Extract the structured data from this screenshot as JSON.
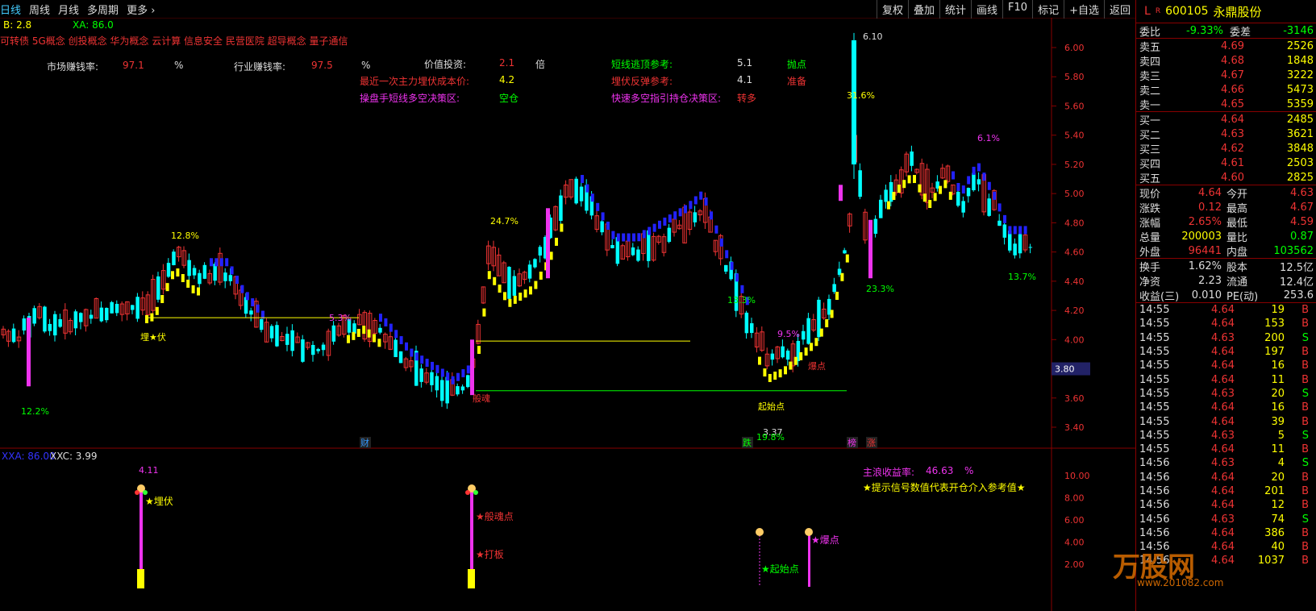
{
  "toolbar": {
    "left_tabs": [
      "日线",
      "周线",
      "月线",
      "多周期",
      "更多 ›"
    ],
    "right_buttons": [
      "复权",
      "叠加",
      "统计",
      "画线",
      "F10",
      "标记",
      "+自选",
      "返回"
    ]
  },
  "indicators_top": {
    "b_label": "B: 2.8",
    "xa_label": "XA: 86.0"
  },
  "concepts": "可转债 5G概念 创投概念 华为概念 云计算 信息安全 民营医院 超导概念 量子通信",
  "info_panel": {
    "market_label": "市场赚钱率:",
    "market_value": "97.1",
    "pct1": "%",
    "industry_label": "行业赚钱率:",
    "industry_value": "97.5",
    "pct2": "%",
    "value_invest_label": "价值投资:",
    "value_invest_value": "2.1",
    "times": "倍",
    "cost_label": "最近一次主力埋伏成本价:",
    "cost_value": "4.2",
    "strategy_label": "操盘手短线多空决策区:",
    "strategy_value": "空仓",
    "escape_label": "短线逃顶参考:",
    "escape_value": "5.1",
    "escape_signal": "抛点",
    "ambush_label": "埋伏反弹参考:",
    "ambush_value": "4.1",
    "ambush_signal": "准备",
    "fast_label": "快速多空指引持仓决策区:",
    "fast_value": "转多"
  },
  "chart_data": {
    "type": "candlestick",
    "y_ticks": [
      "6.00",
      "5.80",
      "5.60",
      "5.40",
      "5.20",
      "5.00",
      "4.80",
      "4.60",
      "4.40",
      "4.20",
      "4.00",
      "3.80",
      "3.60",
      "3.40"
    ],
    "ylim": [
      3.3,
      6.15
    ],
    "current_price_tag": "3.80",
    "annotations": [
      "12.2%",
      "12.8%",
      "埋★伏",
      "5.3%",
      "24.7%",
      "般魂",
      "13.3%",
      "9.5%",
      "爆点",
      "起始点",
      "3.37",
      "19.8%",
      "6.10",
      "31.6%",
      "23.3%",
      "6.1%",
      "13.7%"
    ],
    "bottom_markers": [
      "财",
      "跌",
      "榜",
      "涨"
    ],
    "sub_chart": {
      "legend_xxa": "XXA: 86.00",
      "legend_xxc": "XXC: 3.99",
      "y_ticks": [
        "10.00",
        "8.00",
        "6.00",
        "4.00",
        "2.00"
      ],
      "top_label": "4.11",
      "main_return_label": "主浪收益率:",
      "main_return_value": "46.63",
      "main_return_pct": "%",
      "hint": "★提示信号数值代表开仓介入参考值★",
      "signals": [
        "★埋伏",
        "★般魂点",
        "★打板",
        "★起始点",
        "★爆点"
      ]
    }
  },
  "quote": {
    "l": "L",
    "r": "R",
    "code": "600105",
    "name": "永鼎股份",
    "webi_label": "委比",
    "webi": "-9.33%",
    "weicha_label": "委差",
    "weicha": "-3146",
    "asks": [
      {
        "label": "卖五",
        "price": "4.69",
        "vol": "2526"
      },
      {
        "label": "卖四",
        "price": "4.68",
        "vol": "1848"
      },
      {
        "label": "卖三",
        "price": "4.67",
        "vol": "3222"
      },
      {
        "label": "卖二",
        "price": "4.66",
        "vol": "5473"
      },
      {
        "label": "卖一",
        "price": "4.65",
        "vol": "5359"
      }
    ],
    "bids": [
      {
        "label": "买一",
        "price": "4.64",
        "vol": "2485"
      },
      {
        "label": "买二",
        "price": "4.63",
        "vol": "3621"
      },
      {
        "label": "买三",
        "price": "4.62",
        "vol": "3848"
      },
      {
        "label": "买四",
        "price": "4.61",
        "vol": "2503"
      },
      {
        "label": "买五",
        "price": "4.60",
        "vol": "2825"
      }
    ],
    "stats": [
      {
        "a": "现价",
        "b": "4.64",
        "bc": "#e33",
        "c": "今开",
        "d": "4.63",
        "dc": "#e33"
      },
      {
        "a": "涨跌",
        "b": "0.12",
        "bc": "#e33",
        "c": "最高",
        "d": "4.67",
        "dc": "#e33"
      },
      {
        "a": "涨幅",
        "b": "2.65%",
        "bc": "#e33",
        "c": "最低",
        "d": "4.59",
        "dc": "#e33"
      },
      {
        "a": "总量",
        "b": "200003",
        "bc": "#ff0",
        "c": "量比",
        "d": "0.87",
        "dc": "#0f0"
      },
      {
        "a": "外盘",
        "b": "96441",
        "bc": "#e33",
        "c": "内盘",
        "d": "103562",
        "dc": "#0f0"
      }
    ],
    "stats2": [
      {
        "a": "换手",
        "b": "1.62%",
        "c": "股本",
        "d": "12.5亿"
      },
      {
        "a": "净资",
        "b": "2.23",
        "c": "流通",
        "d": "12.4亿"
      },
      {
        "a": "收益(三)",
        "b": "0.010",
        "c": "PE(动)",
        "d": "253.6"
      }
    ],
    "trades": [
      {
        "t": "14:55",
        "p": "4.64",
        "v": "19",
        "s": "B"
      },
      {
        "t": "14:55",
        "p": "4.64",
        "v": "153",
        "s": "B"
      },
      {
        "t": "14:55",
        "p": "4.63",
        "v": "200",
        "s": "S"
      },
      {
        "t": "14:55",
        "p": "4.64",
        "v": "197",
        "s": "B"
      },
      {
        "t": "14:55",
        "p": "4.64",
        "v": "16",
        "s": "B"
      },
      {
        "t": "14:55",
        "p": "4.64",
        "v": "11",
        "s": "B"
      },
      {
        "t": "14:55",
        "p": "4.63",
        "v": "20",
        "s": "S"
      },
      {
        "t": "14:55",
        "p": "4.64",
        "v": "16",
        "s": "B"
      },
      {
        "t": "14:55",
        "p": "4.64",
        "v": "39",
        "s": "B"
      },
      {
        "t": "14:55",
        "p": "4.63",
        "v": "5",
        "s": "S"
      },
      {
        "t": "14:55",
        "p": "4.64",
        "v": "11",
        "s": "B"
      },
      {
        "t": "14:56",
        "p": "4.63",
        "v": "4",
        "s": "S"
      },
      {
        "t": "14:56",
        "p": "4.64",
        "v": "20",
        "s": "B"
      },
      {
        "t": "14:56",
        "p": "4.64",
        "v": "201",
        "s": "B"
      },
      {
        "t": "14:56",
        "p": "4.64",
        "v": "12",
        "s": "B"
      },
      {
        "t": "14:56",
        "p": "4.63",
        "v": "74",
        "s": "S"
      },
      {
        "t": "14:56",
        "p": "4.64",
        "v": "386",
        "s": "B"
      },
      {
        "t": "14:56",
        "p": "4.64",
        "v": "40",
        "s": "B"
      },
      {
        "t": "14:56",
        "p": "4.64",
        "v": "1037",
        "s": "B"
      }
    ]
  },
  "watermark": {
    "text": "万股网",
    "url": "www.201082.com"
  }
}
